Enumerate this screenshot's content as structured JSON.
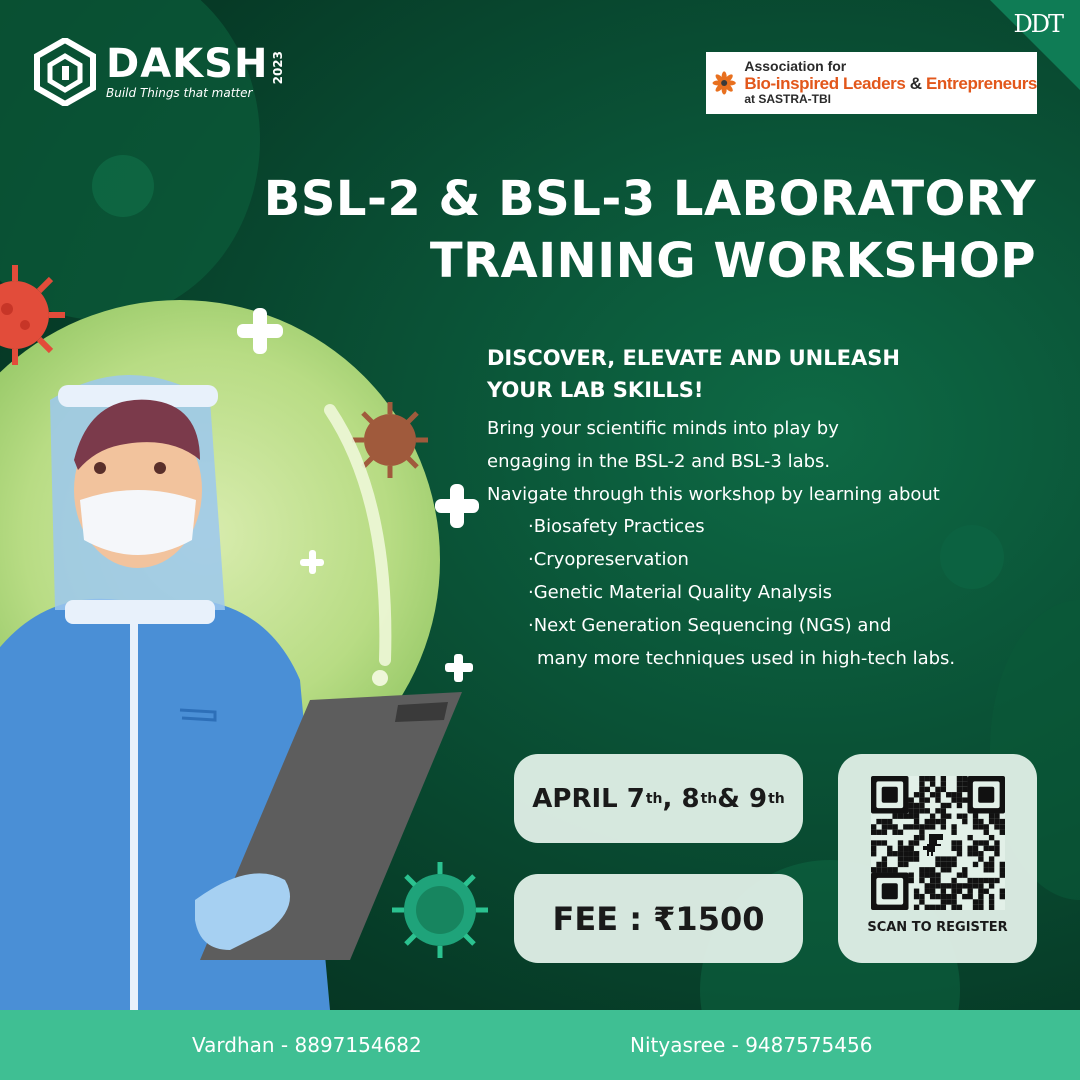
{
  "brand": {
    "name": "DAKSH",
    "year": "2023",
    "tagline": "Build Things that matter",
    "corner_mark": "DDT"
  },
  "association": {
    "line1": "Association for",
    "line2_a": "Bio-inspired Leaders",
    "line2_amp": "&",
    "line2_b": "Entrepreneurs",
    "line3": "at SASTRA-TBI"
  },
  "title": {
    "line1": "BSL-2 & BSL-3 LABORATORY",
    "line2": "TRAINING WORKSHOP"
  },
  "tagline": {
    "line1": "DISCOVER, ELEVATE AND UNLEASH",
    "line2": "YOUR LAB SKILLS!"
  },
  "description": {
    "line1": "Bring your scientific minds into play by",
    "line2": "engaging in the BSL-2 and BSL-3 labs.",
    "line3": "Navigate through this workshop by learning about"
  },
  "topics": [
    "·Biosafety Practices",
    "·Cryopreservation",
    "·Genetic Material Quality Analysis",
    "·Next Generation Sequencing (NGS) and",
    "many more techniques used in high-tech labs."
  ],
  "dates": {
    "prefix": "APRIL 7",
    "s1": "th",
    "mid1": ", 8",
    "s2": "th",
    "mid2": " & 9",
    "s3": "th"
  },
  "fee": "FEE : ₹1500",
  "qr": {
    "label": "SCAN TO REGISTER"
  },
  "contacts": [
    "Vardhan - 8897154682",
    "Nityasree - 9487575456"
  ],
  "colors": {
    "background": "#0a5236",
    "footer": "#3fbf93",
    "pill": "#e2f0e8",
    "accent_orange": "#e2571b"
  }
}
